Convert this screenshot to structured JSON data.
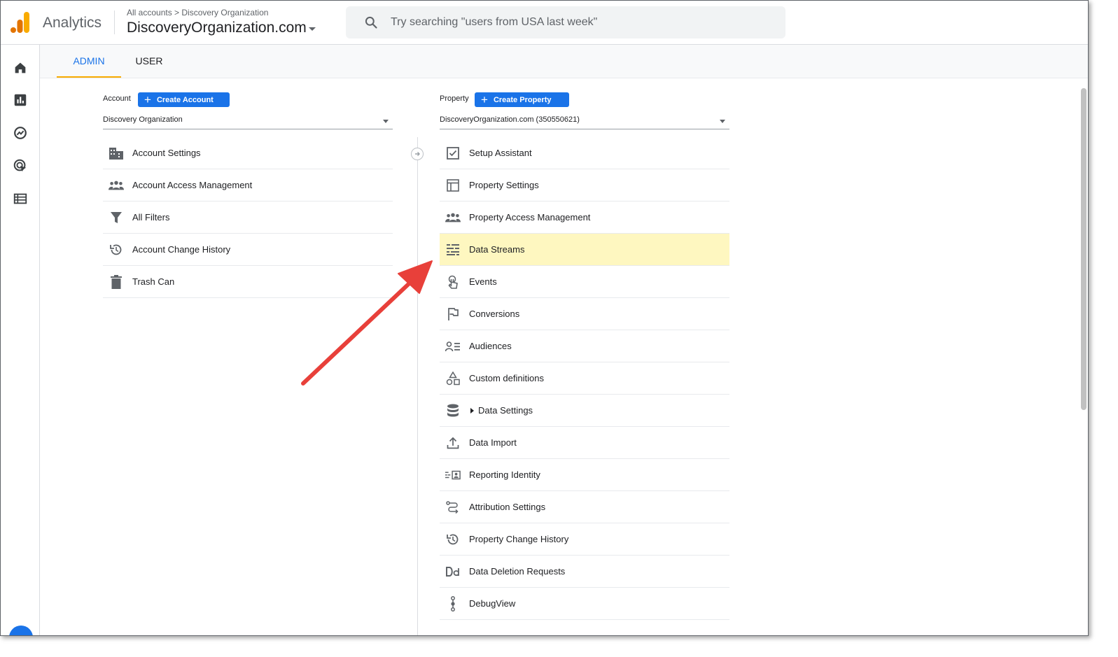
{
  "header": {
    "app_name": "Analytics",
    "breadcrumb": "All accounts > Discovery Organization",
    "property_name": "DiscoveryOrganization.com",
    "search_placeholder": "Try searching \"users from USA last week\""
  },
  "rail": {
    "items": [
      "home-icon",
      "reports-icon",
      "explore-icon",
      "advertising-icon",
      "configure-icon"
    ]
  },
  "tabs": [
    {
      "label": "ADMIN",
      "active": true
    },
    {
      "label": "USER",
      "active": false
    }
  ],
  "account": {
    "label": "Account",
    "create_label": "Create Account",
    "selected": "Discovery Organization",
    "items": [
      {
        "label": "Account Settings",
        "icon": "building-icon"
      },
      {
        "label": "Account Access Management",
        "icon": "people-icon"
      },
      {
        "label": "All Filters",
        "icon": "filter-icon"
      },
      {
        "label": "Account Change History",
        "icon": "history-icon"
      },
      {
        "label": "Trash Can",
        "icon": "trash-icon"
      }
    ]
  },
  "property": {
    "label": "Property",
    "create_label": "Create Property",
    "selected": "DiscoveryOrganization.com (350550621)",
    "items": [
      {
        "label": "Setup Assistant",
        "icon": "checkbox-icon"
      },
      {
        "label": "Property Settings",
        "icon": "layout-icon"
      },
      {
        "label": "Property Access Management",
        "icon": "people-icon"
      },
      {
        "label": "Data Streams",
        "icon": "streams-icon",
        "highlighted": true
      },
      {
        "label": "Events",
        "icon": "touch-icon"
      },
      {
        "label": "Conversions",
        "icon": "flag-icon"
      },
      {
        "label": "Audiences",
        "icon": "audiences-icon"
      },
      {
        "label": "Custom definitions",
        "icon": "shapes-icon"
      },
      {
        "label": "Data Settings",
        "icon": "database-icon",
        "expandable": true
      },
      {
        "label": "Data Import",
        "icon": "upload-icon"
      },
      {
        "label": "Reporting Identity",
        "icon": "identity-icon"
      },
      {
        "label": "Attribution Settings",
        "icon": "attribution-icon"
      },
      {
        "label": "Property Change History",
        "icon": "history-icon"
      },
      {
        "label": "Data Deletion Requests",
        "icon": "dd-icon"
      },
      {
        "label": "DebugView",
        "icon": "debug-icon"
      }
    ]
  },
  "colors": {
    "accent": "#1a73e8",
    "tab_underline": "#f9ab00",
    "highlight": "#fef7c0",
    "annotation_arrow": "#e8403a"
  }
}
